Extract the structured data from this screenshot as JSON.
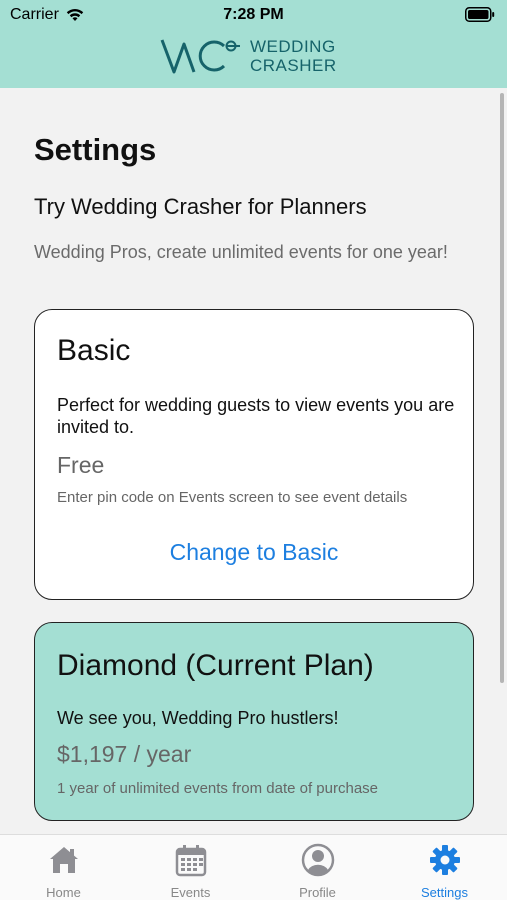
{
  "status_bar": {
    "carrier": "Carrier",
    "time": "7:28 PM"
  },
  "logo": {
    "line1": "WEDDING",
    "line2": "CRASHER"
  },
  "page": {
    "title": "Settings",
    "subtitle": "Try Wedding Crasher for Planners",
    "description": "Wedding Pros, create unlimited events for one year!"
  },
  "plans": {
    "basic": {
      "name": "Basic",
      "description": "Perfect for wedding guests to view events you are invited to.",
      "price": "Free",
      "note": "Enter pin code on Events screen to see event details",
      "action": "Change to Basic"
    },
    "diamond": {
      "name": "Diamond (Current Plan)",
      "description": "We see you, Wedding Pro hustlers!",
      "price": "$1,197 / year",
      "note": "1 year of unlimited events from date of purchase"
    }
  },
  "tabs": [
    {
      "label": "Home",
      "icon": "home-icon"
    },
    {
      "label": "Events",
      "icon": "calendar-icon"
    },
    {
      "label": "Profile",
      "icon": "person-icon"
    },
    {
      "label": "Settings",
      "icon": "gear-icon"
    }
  ],
  "colors": {
    "header_bg": "#a4dfd3",
    "accent": "#1d7fe0",
    "brand": "#16636a"
  }
}
